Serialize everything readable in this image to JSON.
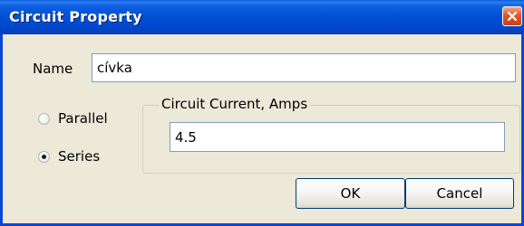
{
  "window": {
    "title": "Circuit Property"
  },
  "name_field": {
    "label": "Name",
    "value": "cívka"
  },
  "connection": {
    "options": [
      {
        "label": "Parallel",
        "selected": false
      },
      {
        "label": "Series",
        "selected": true
      }
    ]
  },
  "current_group": {
    "title": "Circuit Current, Amps",
    "value": "4.5"
  },
  "buttons": {
    "ok_label": "OK",
    "cancel_label": "Cancel"
  },
  "colors": {
    "titlebar": "#0050d6",
    "dialog_bg": "#ece9d8",
    "close_button": "#e2552b"
  }
}
